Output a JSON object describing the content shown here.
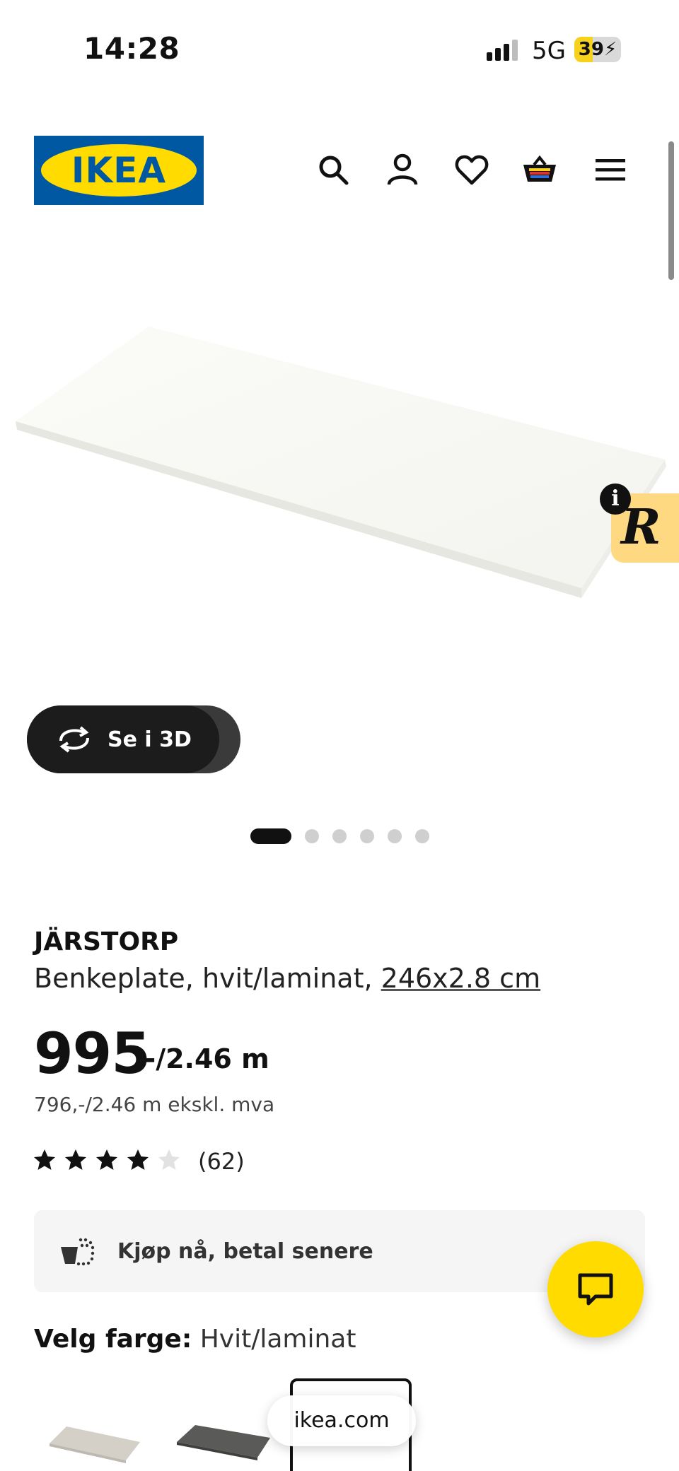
{
  "status_bar": {
    "time": "14:28",
    "network": "5G",
    "battery": "39",
    "battery_level": 0.39,
    "charging_icon": "bolt-icon"
  },
  "header": {
    "logo_text": "IKEA",
    "icons": [
      "search-icon",
      "account-icon",
      "heart-icon",
      "basket-icon",
      "menu-icon"
    ]
  },
  "gallery": {
    "view_3d_label": "Se i 3D",
    "image_count": 6,
    "active_index": 0
  },
  "product": {
    "name": "JÄRSTORP",
    "description": "Benkeplate, hvit/laminat,",
    "size": "246x2.8 cm",
    "price": "995",
    "price_suffix": ",-/2.46 m",
    "price_ex_vat": "796,-/2.46 m ekskl. mva",
    "rating": 4,
    "rating_max": 5,
    "review_count": "(62)"
  },
  "bnpl": {
    "label": "Kjøp nå, betal senere"
  },
  "color": {
    "label": "Velg farge:",
    "value": "Hvit/laminat"
  },
  "browser": {
    "url": "ikea.com"
  },
  "colors": {
    "ikea_blue": "#0058a3",
    "ikea_yellow": "#ffdb00"
  }
}
